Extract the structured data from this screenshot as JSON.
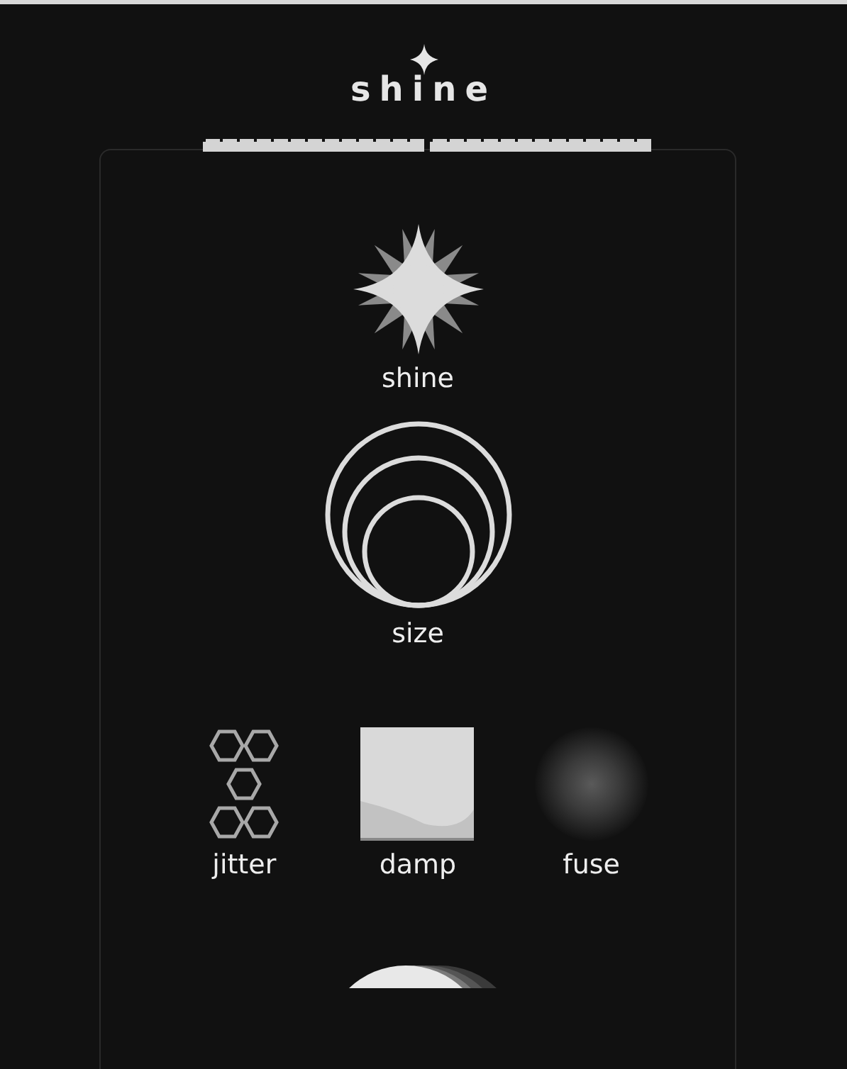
{
  "logo": "shine",
  "rows": [
    [
      {
        "kind": "shine",
        "label": "shine"
      }
    ],
    [
      {
        "kind": "size",
        "label": "size"
      }
    ],
    [
      {
        "kind": "jitter",
        "label": "jitter"
      },
      {
        "kind": "damp",
        "label": "damp"
      },
      {
        "kind": "fuse",
        "label": "fuse"
      }
    ],
    [
      {
        "kind": "layers"
      }
    ]
  ]
}
